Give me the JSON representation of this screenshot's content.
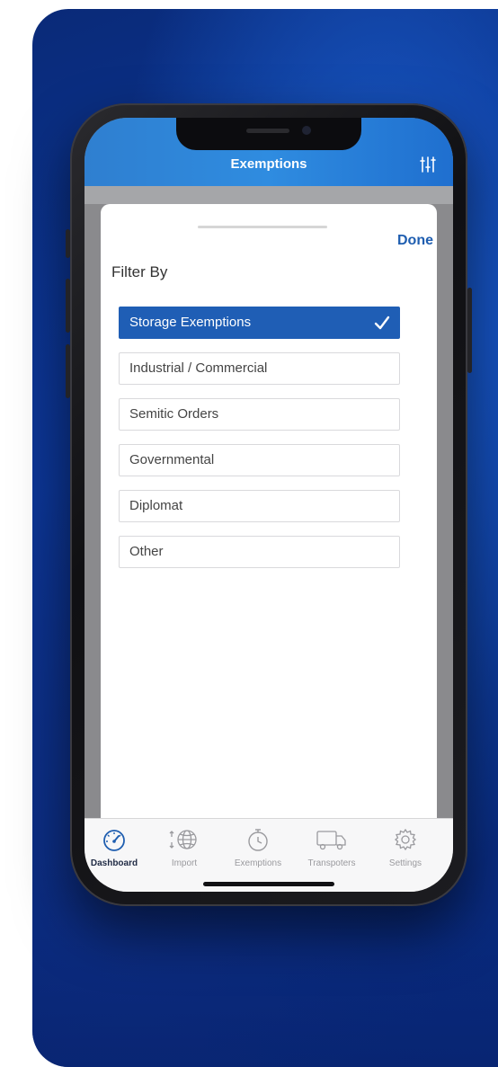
{
  "header": {
    "title": "Exemptions",
    "filter_icon": "sliders-icon"
  },
  "sheet": {
    "done_label": "Done",
    "heading": "Filter By",
    "options": [
      {
        "label": "Storage Exemptions",
        "selected": true
      },
      {
        "label": "Industrial / Commercial",
        "selected": false
      },
      {
        "label": "Semitic Orders",
        "selected": false
      },
      {
        "label": "Governmental",
        "selected": false
      },
      {
        "label": "Diplomat",
        "selected": false
      },
      {
        "label": "Other",
        "selected": false
      }
    ]
  },
  "tabbar": {
    "tabs": [
      {
        "label": "Dashboard",
        "icon": "speedometer-icon",
        "active": true
      },
      {
        "label": "Import",
        "icon": "globe-icon",
        "active": false
      },
      {
        "label": "Exemptions",
        "icon": "stopwatch-icon",
        "active": false
      },
      {
        "label": "Transpoters",
        "icon": "truck-icon",
        "active": false
      },
      {
        "label": "Settings",
        "icon": "gear-icon",
        "active": false
      }
    ]
  },
  "colors": {
    "header_blue": "#2f85d8",
    "selected_blue": "#1f5eb5",
    "done_blue": "#1f5eb0",
    "background_blue": "#0b3aa0"
  }
}
